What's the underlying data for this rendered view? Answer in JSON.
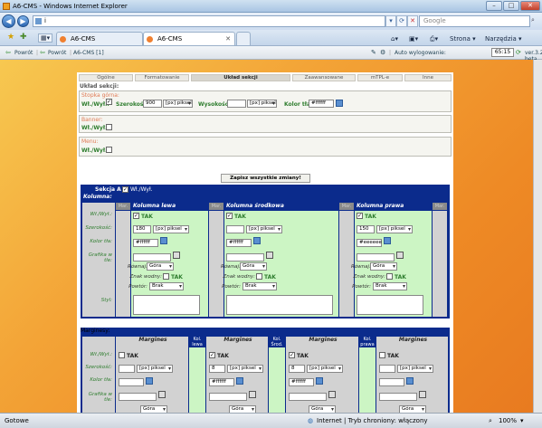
{
  "window": {
    "title": "A6-CMS - Windows Internet Explorer"
  },
  "address": {
    "url": "i"
  },
  "search": {
    "placeholder": "Google"
  },
  "tabs": [
    {
      "label": "A6-CMS"
    },
    {
      "label": "A6-CMS"
    }
  ],
  "toolbar": {
    "page": "Strona",
    "tools": "Narzędzia"
  },
  "appbar": {
    "back1": "Powrót",
    "back2": "Powrót",
    "section": "A6-CMS [1]",
    "auto_label": "Auto wylogowanie:",
    "auto_value": "65:15",
    "version": "ver.3.25 beta"
  },
  "content_tabs": [
    {
      "label": "Ogólne"
    },
    {
      "label": "Formatowanie"
    },
    {
      "label": "Układ sekcji"
    },
    {
      "label": "Zaawansowane"
    },
    {
      "label": "mTPL-e"
    },
    {
      "label": "Inne"
    }
  ],
  "layout_label": "Układ sekcji:",
  "top_strip": {
    "title": "Stopka górna:",
    "onoff": "Wł./Wył.:",
    "width_label": "Szerokość:",
    "width_value": "900",
    "width_unit": "[px] piksel",
    "height_label": "Wysokość:",
    "height_unit": "[px] piksel",
    "color_label": "Kolor tła:",
    "color_value": "#ffffff"
  },
  "banner": {
    "title": "Banner:",
    "onoff": "Wł./Wył.:"
  },
  "menu": {
    "title": "Menu:",
    "onoff": "Wł./Wył.:"
  },
  "save_all": "Zapisz wszystkie zmiany!",
  "section_a": {
    "title": "Sekcja A",
    "onoff": "Wł./Wył.",
    "columns_label": "Kolumna:"
  },
  "mar": "Mar.",
  "columns": [
    {
      "name": "Kolumna lewa",
      "tak": "TAK",
      "width": "180",
      "unit": "[px] piksel",
      "color": "#ffffff",
      "align": "Góra",
      "wm_label": "Znak wodny:",
      "wm_value": "TAK",
      "repeat": "Brak"
    },
    {
      "name": "Kolumna środkowa",
      "tak": "TAK",
      "width": "",
      "unit": "[px] piksel",
      "color": "#ffffff",
      "align": "Góra",
      "wm_label": "Znak wodny:",
      "wm_value": "TAK",
      "repeat": "Brak"
    },
    {
      "name": "Kolumna prawa",
      "tak": "TAK",
      "width": "150",
      "unit": "[px] piksel",
      "color": "#eeeeee",
      "align": "Góra",
      "wm_label": "Znak wodny:",
      "wm_value": "TAK",
      "repeat": "Brak"
    }
  ],
  "rows": {
    "onoff": "Wł./Wył.:",
    "width": "Szerokość:",
    "color": "Kolor tła:",
    "graphic1": "Grafika w",
    "graphic2": "tle:",
    "align": "Równaj:",
    "repeat": "Powtór:",
    "style": "Styl:"
  },
  "margins_label": "Marginesy:",
  "margins_cols": [
    {
      "name": "Margines",
      "onoff": "TAK",
      "checked": false,
      "width": "",
      "unit": "[px] piksel"
    },
    {
      "name": "Margines",
      "onoff": "TAK",
      "checked": true,
      "width": "8",
      "unit": "[px] piksel"
    },
    {
      "name": "Margines",
      "onoff": "TAK",
      "checked": true,
      "width": "8",
      "unit": "[px] piksel"
    },
    {
      "name": "Margines",
      "onoff": "TAK",
      "checked": false,
      "width": "",
      "unit": "[px] piksel"
    }
  ],
  "margins_between": [
    {
      "l1": "Kol.",
      "l2": "lewa"
    },
    {
      "l1": "Kol.",
      "l2": "Środ."
    },
    {
      "l1": "Kol.",
      "l2": "prawa"
    }
  ],
  "margin_color": "#ffffff",
  "margin_align": "Góra",
  "status": {
    "left": "Gotowe",
    "zone": "Internet | Tryb chroniony: włączony",
    "zoom": "100%"
  },
  "colors": {
    "accent_blue": "#0b2b8c",
    "green_col": "#ccf5c4",
    "orange_bg": "#f3a437"
  }
}
